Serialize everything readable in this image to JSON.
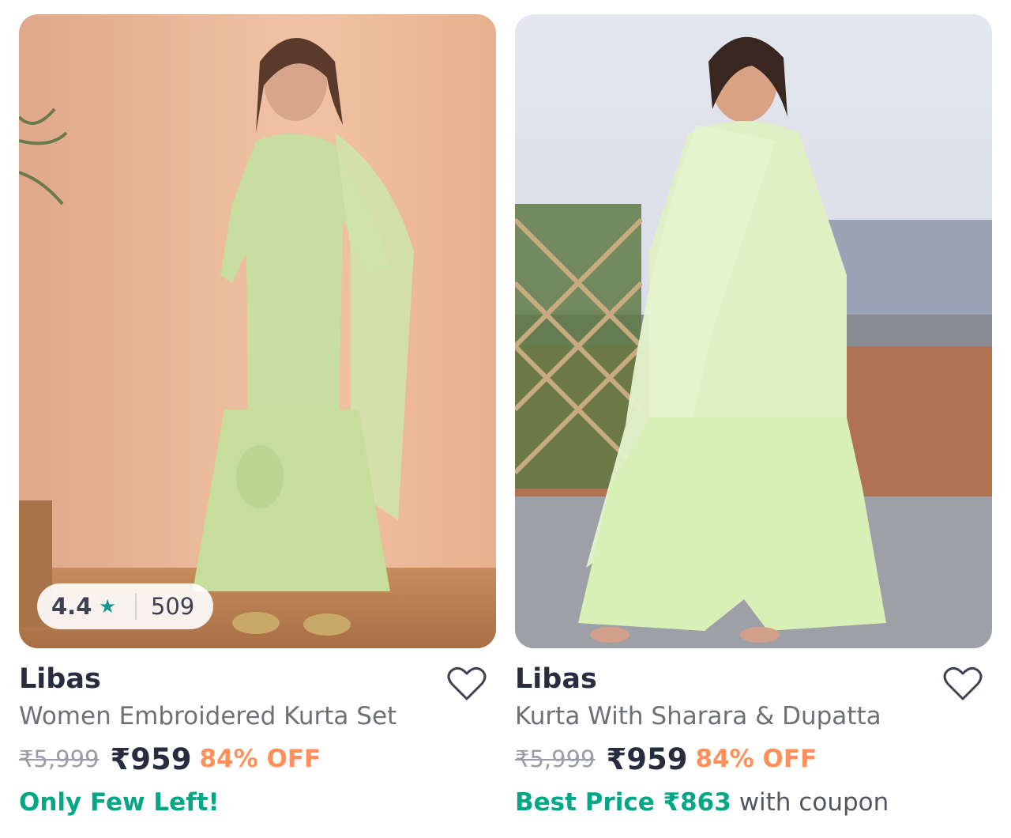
{
  "products": [
    {
      "brand": "Libas",
      "name": "Women Embroidered Kurta Set",
      "rating": "4.4",
      "rating_star": "★",
      "rating_count": "509",
      "mrp": "₹5,999",
      "price": "₹959",
      "discount": "84% OFF",
      "tag_highlight": "Only Few Left!",
      "tag_suffix": "",
      "icons": {
        "wishlist": "heart-outline-icon",
        "rating": "star-icon"
      }
    },
    {
      "brand": "Libas",
      "name": "Kurta With Sharara & Dupatta",
      "mrp": "₹5,999",
      "price": "₹959",
      "discount": "84% OFF",
      "tag_highlight": "Best Price ₹863",
      "tag_suffix": "with coupon",
      "icons": {
        "wishlist": "heart-outline-icon"
      }
    }
  ],
  "colors": {
    "brand_text": "#282c3f",
    "product_name": "#6d6f79",
    "mrp": "#9a9ca7",
    "discount": "#ff905a",
    "highlight_green": "#03a685",
    "rating_star": "#14958f"
  }
}
